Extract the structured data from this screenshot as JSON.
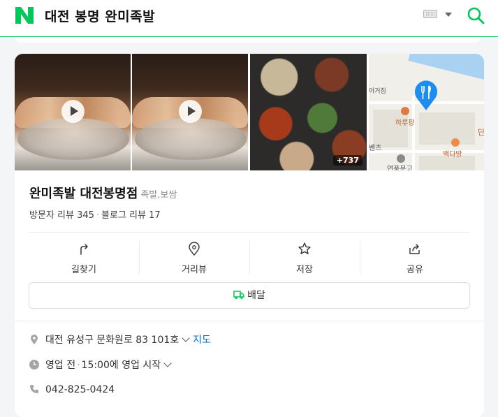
{
  "header": {
    "query": "대전 봉명 완미족발",
    "brand_color": "#03c75a",
    "icons": [
      "naver-logo-icon",
      "keyboard-icon",
      "caret-down-icon",
      "search-icon"
    ]
  },
  "photos": {
    "more_count": "+737",
    "map_labels": [
      "하루팡",
      "단",
      "벤츠",
      "백다방",
      "연풍문고",
      "어거집"
    ]
  },
  "place": {
    "name": "완미족발 대전봉명점",
    "category": "족발,보쌈",
    "visitor_reviews": "방문자 리뷰 345",
    "separator": "·",
    "blog_reviews": "블로그 리뷰 17"
  },
  "actions": [
    {
      "label": "길찾기",
      "icon": "directions-icon"
    },
    {
      "label": "거리뷰",
      "icon": "streetview-pin-icon"
    },
    {
      "label": "저장",
      "icon": "star-icon"
    },
    {
      "label": "공유",
      "icon": "share-icon"
    }
  ],
  "delivery": {
    "label": "배달",
    "icon": "delivery-truck-icon",
    "color": "#03c75a"
  },
  "info": {
    "address": "대전 유성구 문화원로 83 101호",
    "map_link": "지도",
    "status": "영업 전",
    "hours": "15:00에 영업 시작",
    "phone": "042-825-0424"
  }
}
